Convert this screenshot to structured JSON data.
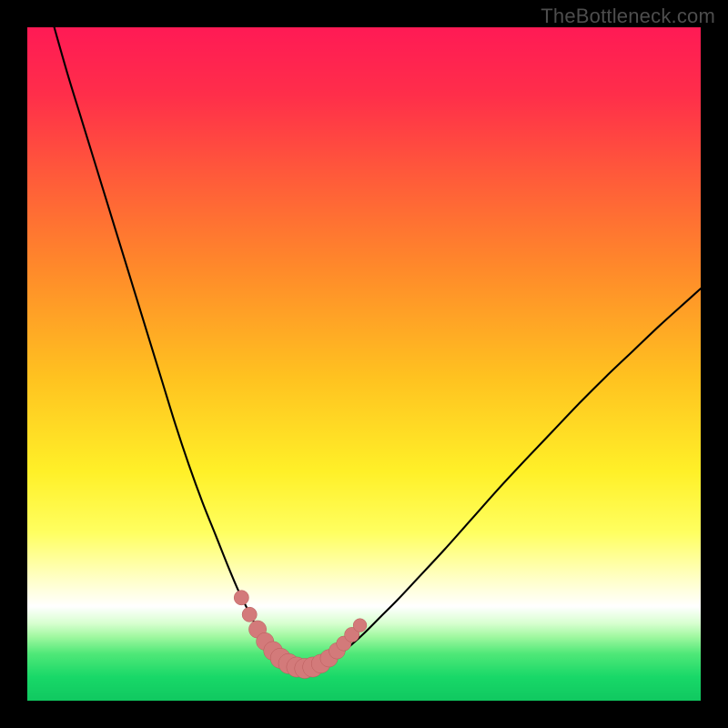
{
  "watermark": "TheBottleneck.com",
  "colors": {
    "frame": "#000000",
    "curve": "#000000",
    "marker_fill": "#d37a7a",
    "marker_stroke": "#b85a5a",
    "gradient_stops": [
      {
        "offset": 0.0,
        "color": "#ff1a55"
      },
      {
        "offset": 0.1,
        "color": "#ff2e4a"
      },
      {
        "offset": 0.22,
        "color": "#ff5a3a"
      },
      {
        "offset": 0.36,
        "color": "#ff8a2a"
      },
      {
        "offset": 0.52,
        "color": "#ffc220"
      },
      {
        "offset": 0.66,
        "color": "#fff028"
      },
      {
        "offset": 0.75,
        "color": "#ffff60"
      },
      {
        "offset": 0.82,
        "color": "#ffffc8"
      },
      {
        "offset": 0.86,
        "color": "#ffffff"
      },
      {
        "offset": 0.885,
        "color": "#d8ffd0"
      },
      {
        "offset": 0.905,
        "color": "#a0f8a0"
      },
      {
        "offset": 0.93,
        "color": "#50e878"
      },
      {
        "offset": 0.965,
        "color": "#18d868"
      },
      {
        "offset": 1.0,
        "color": "#10c860"
      }
    ]
  },
  "chart_data": {
    "type": "line",
    "title": "",
    "xlabel": "",
    "ylabel": "",
    "xlim": [
      0,
      100
    ],
    "ylim": [
      0,
      100
    ],
    "series": [
      {
        "name": "left-curve",
        "x": [
          4,
          6,
          8,
          10,
          12,
          14,
          16,
          18,
          20,
          22,
          24,
          26,
          28,
          30,
          31.5,
          33,
          34.5,
          35.5,
          36.5,
          37.5,
          38.5,
          39.6,
          41
        ],
        "y": [
          100,
          93,
          86.5,
          80,
          73.5,
          67,
          60.5,
          54,
          47.5,
          41,
          35,
          29.5,
          24.5,
          19.5,
          16,
          13,
          10,
          8.5,
          7.3,
          6.3,
          5.5,
          5,
          4.8
        ]
      },
      {
        "name": "right-curve",
        "x": [
          41,
          43,
          45,
          46.5,
          48,
          50,
          52.5,
          55,
          58,
          62,
          66,
          70,
          74,
          78,
          82,
          86,
          90,
          94,
          98,
          100
        ],
        "y": [
          4.8,
          5.2,
          6.0,
          7.0,
          8.2,
          10,
          12.5,
          15,
          18.2,
          22.5,
          27,
          31.5,
          35.8,
          40,
          44.2,
          48.2,
          52,
          55.8,
          59.4,
          61.2
        ]
      }
    ],
    "markers": {
      "name": "highlight-points",
      "points": [
        {
          "x": 31.8,
          "y": 15.3,
          "r": 1.1
        },
        {
          "x": 33.0,
          "y": 12.8,
          "r": 1.1
        },
        {
          "x": 34.2,
          "y": 10.6,
          "r": 1.3
        },
        {
          "x": 35.3,
          "y": 8.8,
          "r": 1.3
        },
        {
          "x": 36.5,
          "y": 7.4,
          "r": 1.4
        },
        {
          "x": 37.6,
          "y": 6.3,
          "r": 1.5
        },
        {
          "x": 38.8,
          "y": 5.5,
          "r": 1.5
        },
        {
          "x": 40.0,
          "y": 5.0,
          "r": 1.5
        },
        {
          "x": 41.2,
          "y": 4.8,
          "r": 1.5
        },
        {
          "x": 42.4,
          "y": 5.0,
          "r": 1.5
        },
        {
          "x": 43.6,
          "y": 5.5,
          "r": 1.4
        },
        {
          "x": 44.8,
          "y": 6.3,
          "r": 1.3
        },
        {
          "x": 46.0,
          "y": 7.4,
          "r": 1.2
        },
        {
          "x": 47.0,
          "y": 8.5,
          "r": 1.1
        },
        {
          "x": 48.2,
          "y": 9.8,
          "r": 1.1
        },
        {
          "x": 49.4,
          "y": 11.2,
          "r": 1.0
        }
      ]
    }
  }
}
